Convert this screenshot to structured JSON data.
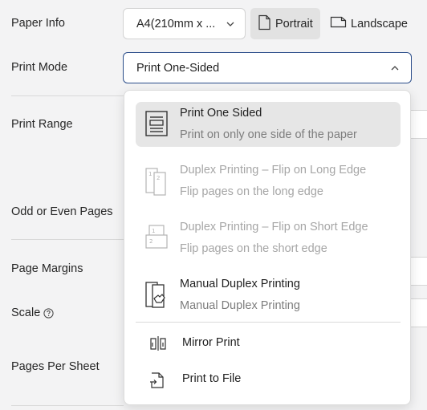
{
  "labels": {
    "paper_info": "Paper Info",
    "print_mode": "Print Mode",
    "print_range": "Print Range",
    "odd_even": "Odd or Even Pages",
    "page_margins": "Page Margins",
    "scale": "Scale",
    "pages_per_sheet": "Pages Per Sheet"
  },
  "paper": {
    "size_value": "A4(210mm x ...",
    "portrait_label": "Portrait",
    "landscape_label": "Landscape",
    "selected_orientation": "Portrait"
  },
  "print_mode": {
    "value": "Print One-Sided"
  },
  "dropdown": {
    "options": [
      {
        "title": "Print One Sided",
        "desc": "Print on only one side of the paper",
        "icon": "one-sided-page-icon",
        "state": "selected"
      },
      {
        "title": "Duplex Printing – Flip on Long Edge",
        "desc": "Flip pages on the long edge",
        "icon": "duplex-long-edge-icon",
        "state": "disabled"
      },
      {
        "title": "Duplex Printing – Flip on Short Edge",
        "desc": "Flip pages on the short edge",
        "icon": "duplex-short-edge-icon",
        "state": "disabled"
      },
      {
        "title": "Manual Duplex Printing",
        "desc": "Manual Duplex Printing",
        "icon": "manual-duplex-icon",
        "state": "enabled"
      }
    ],
    "extra": [
      {
        "title": "Mirror Print",
        "icon": "mirror-print-icon"
      },
      {
        "title": "Print to File",
        "icon": "print-to-file-icon"
      }
    ]
  },
  "colors": {
    "focus_border": "#2b4d8a",
    "selected_bg": "#e6e6e6",
    "disabled_text": "#a6a6a6"
  }
}
